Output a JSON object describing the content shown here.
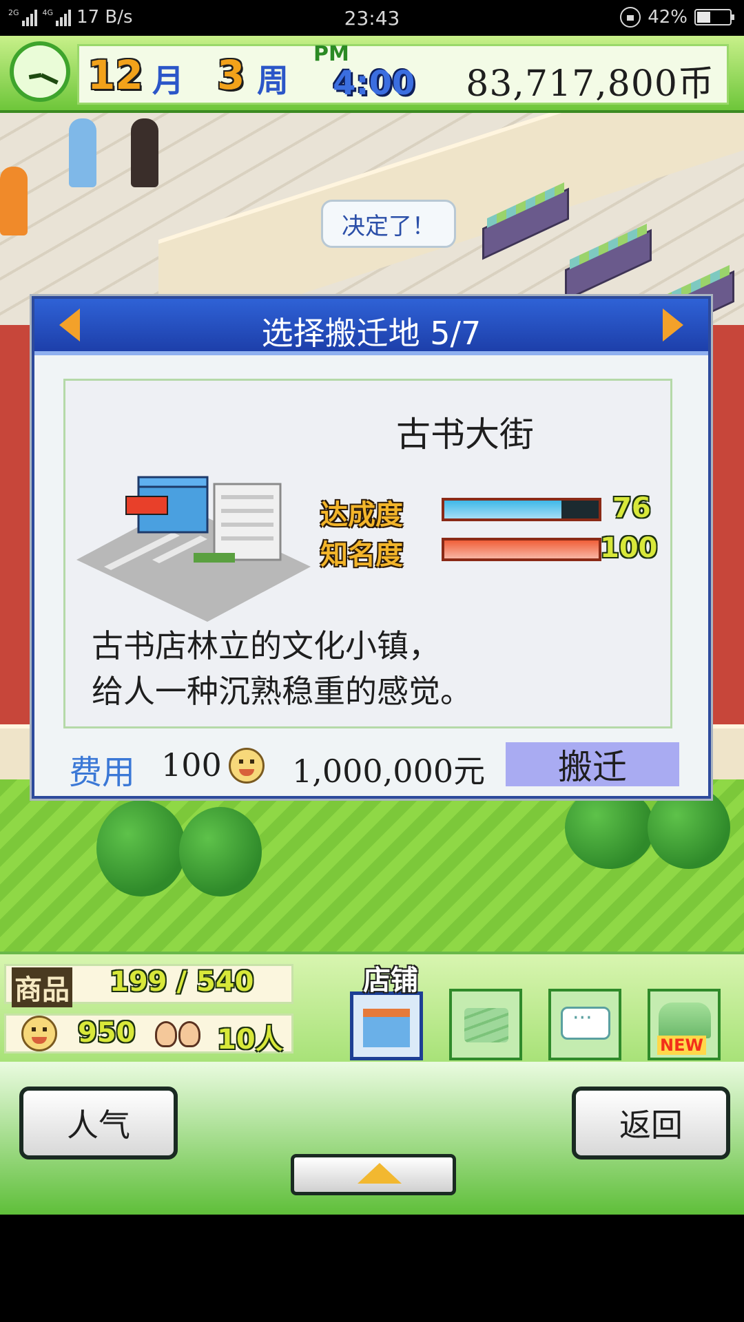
{
  "status_bar": {
    "signal_labels": [
      "2G",
      "4G"
    ],
    "speed": "17 B/s",
    "time": "23:43",
    "battery_percent": "42%",
    "battery_level": 0.42
  },
  "hud": {
    "month_num": "12",
    "month_label": "月",
    "week_num": "3",
    "week_label": "周",
    "ampm": "PM",
    "clock_time": "4:00",
    "money": "83,717,800币"
  },
  "scene": {
    "speech_bubble": "决定了！"
  },
  "dialog": {
    "title": "选择搬迁地 5/7",
    "location_name": "古书大街",
    "stats": [
      {
        "label": "达成度",
        "value": "76",
        "level": 0.76,
        "color": "#3fb8e8"
      },
      {
        "label": "知名度",
        "value": "100",
        "level": 1.0,
        "color": "#f0603a"
      }
    ],
    "description_lines": [
      "古书店林立的文化小镇，",
      "给人一种沉熟稳重的感觉。"
    ],
    "cost_label": "费用",
    "cost_points": "100",
    "cost_money": "1,000,000元",
    "move_button": "搬迁"
  },
  "bottom_hud": {
    "goods_label": "商品",
    "goods_value": "199 / 540",
    "points_value": "950",
    "people_value": "10人",
    "store_tab_label": "店铺",
    "new_badge": "NEW"
  },
  "bottom_bar": {
    "left_button": "人气",
    "right_button": "返回"
  }
}
